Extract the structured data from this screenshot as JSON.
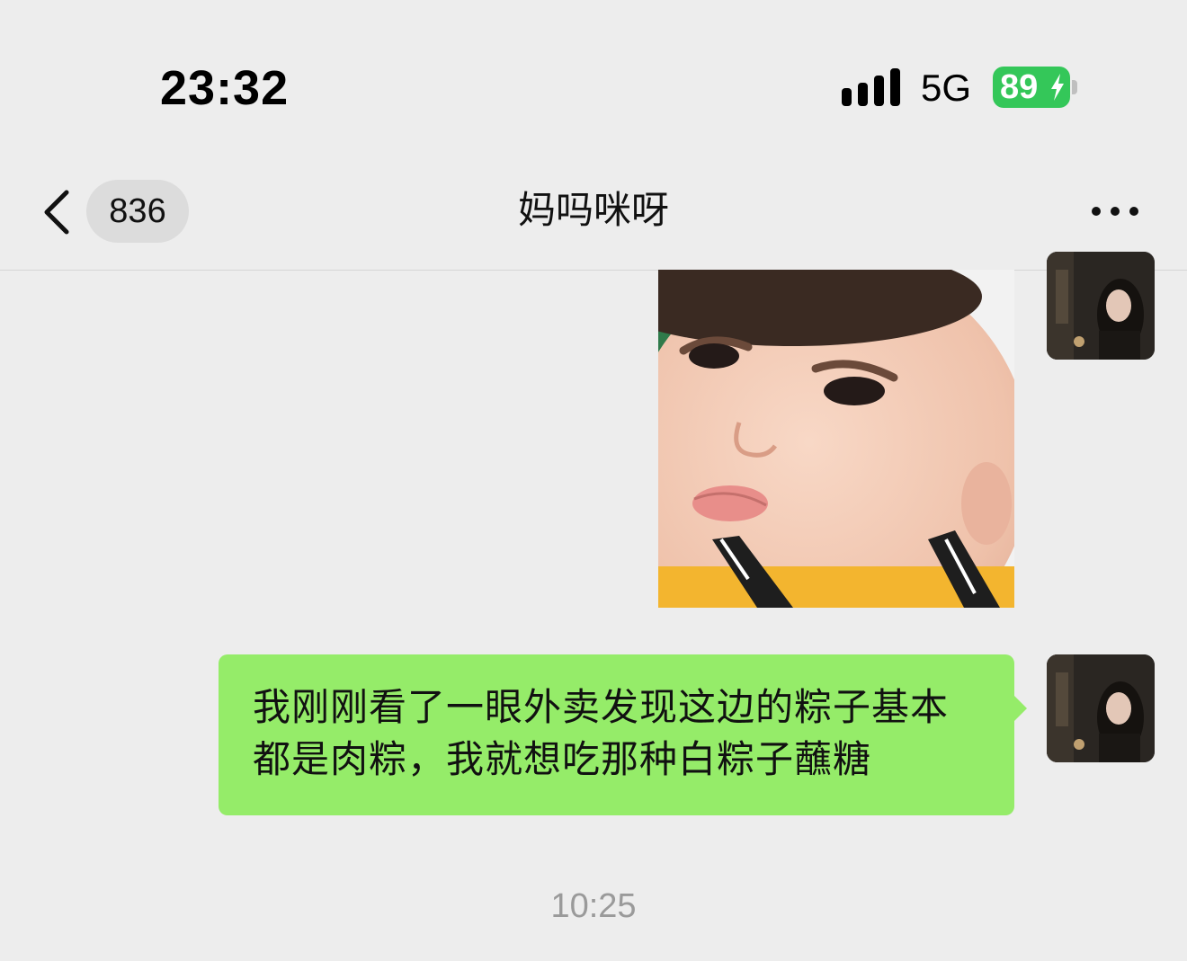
{
  "status_bar": {
    "time": "23:32",
    "network": "5G",
    "battery": "89",
    "battery_color": "#34c759",
    "icons": [
      "signal-icon",
      "charging-bolt-icon"
    ]
  },
  "nav": {
    "unread_count": "836",
    "title": "妈吗咪呀",
    "icons": [
      "back-chevron-icon",
      "more-dots-icon"
    ]
  },
  "messages": [
    {
      "type": "image",
      "sender": "self",
      "content": "photo of a toddler's face"
    },
    {
      "type": "text",
      "sender": "self",
      "text": "我刚刚看了一眼外卖发现这边的粽子基本都是肉粽，我就想吃那种白粽子蘸糖"
    }
  ],
  "timestamp": "10:25",
  "colors": {
    "background": "#ededed",
    "bubble_green": "#95ec69"
  }
}
